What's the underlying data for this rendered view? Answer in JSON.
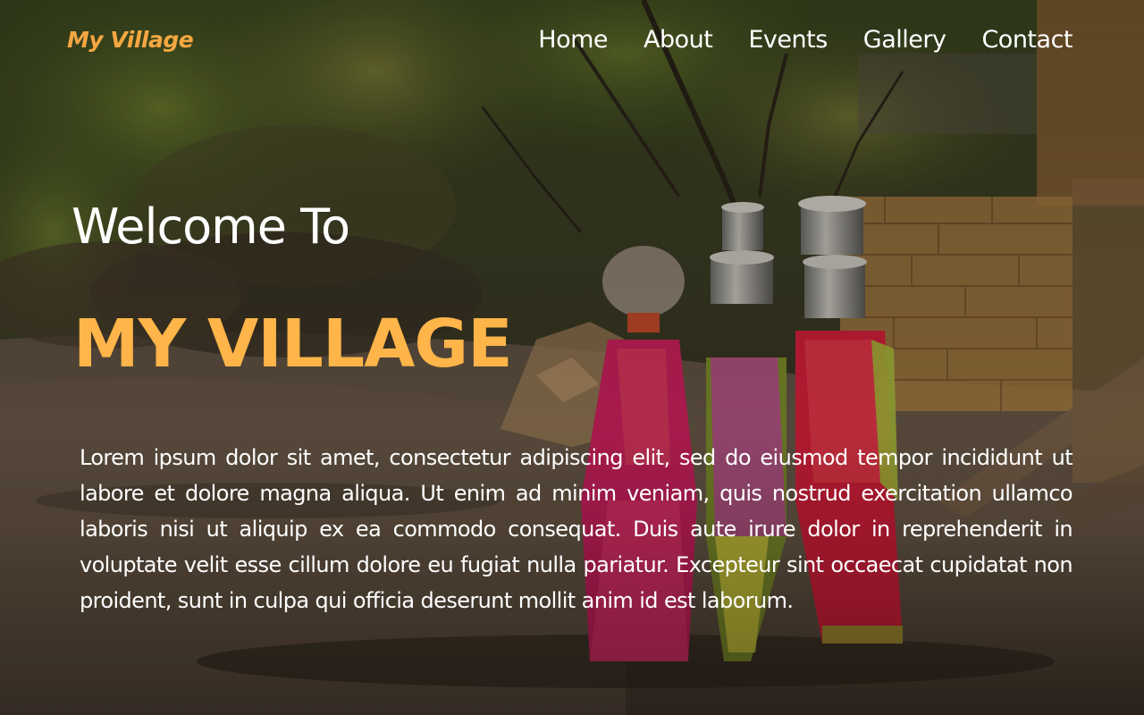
{
  "header": {
    "logo_text": "My Village",
    "nav": [
      {
        "label": "Home"
      },
      {
        "label": "About"
      },
      {
        "label": "Events"
      },
      {
        "label": "Gallery"
      },
      {
        "label": "Contact"
      }
    ]
  },
  "hero": {
    "welcome": "Welcome To",
    "title": "MY VILLAGE",
    "paragraph": "Lorem ipsum dolor sit amet, consectetur adipiscing elit, sed do eiusmod tempor incididunt ut labore et dolore magna aliqua. Ut enim ad minim veniam, quis nostrud exercitation ullamco laboris nisi ut aliquip ex ea commodo consequat. Duis aute irure dolor in reprehenderit in voluptate velit esse cillum dolore eu fugiat nulla pariatur. Excepteur sint occaecat cupidatat non proident, sunt in culpa qui officia deserunt mollit anim id est laborum."
  },
  "colors": {
    "logo": "#f5a742",
    "title": "#ffb549",
    "text": "#ffffff"
  }
}
